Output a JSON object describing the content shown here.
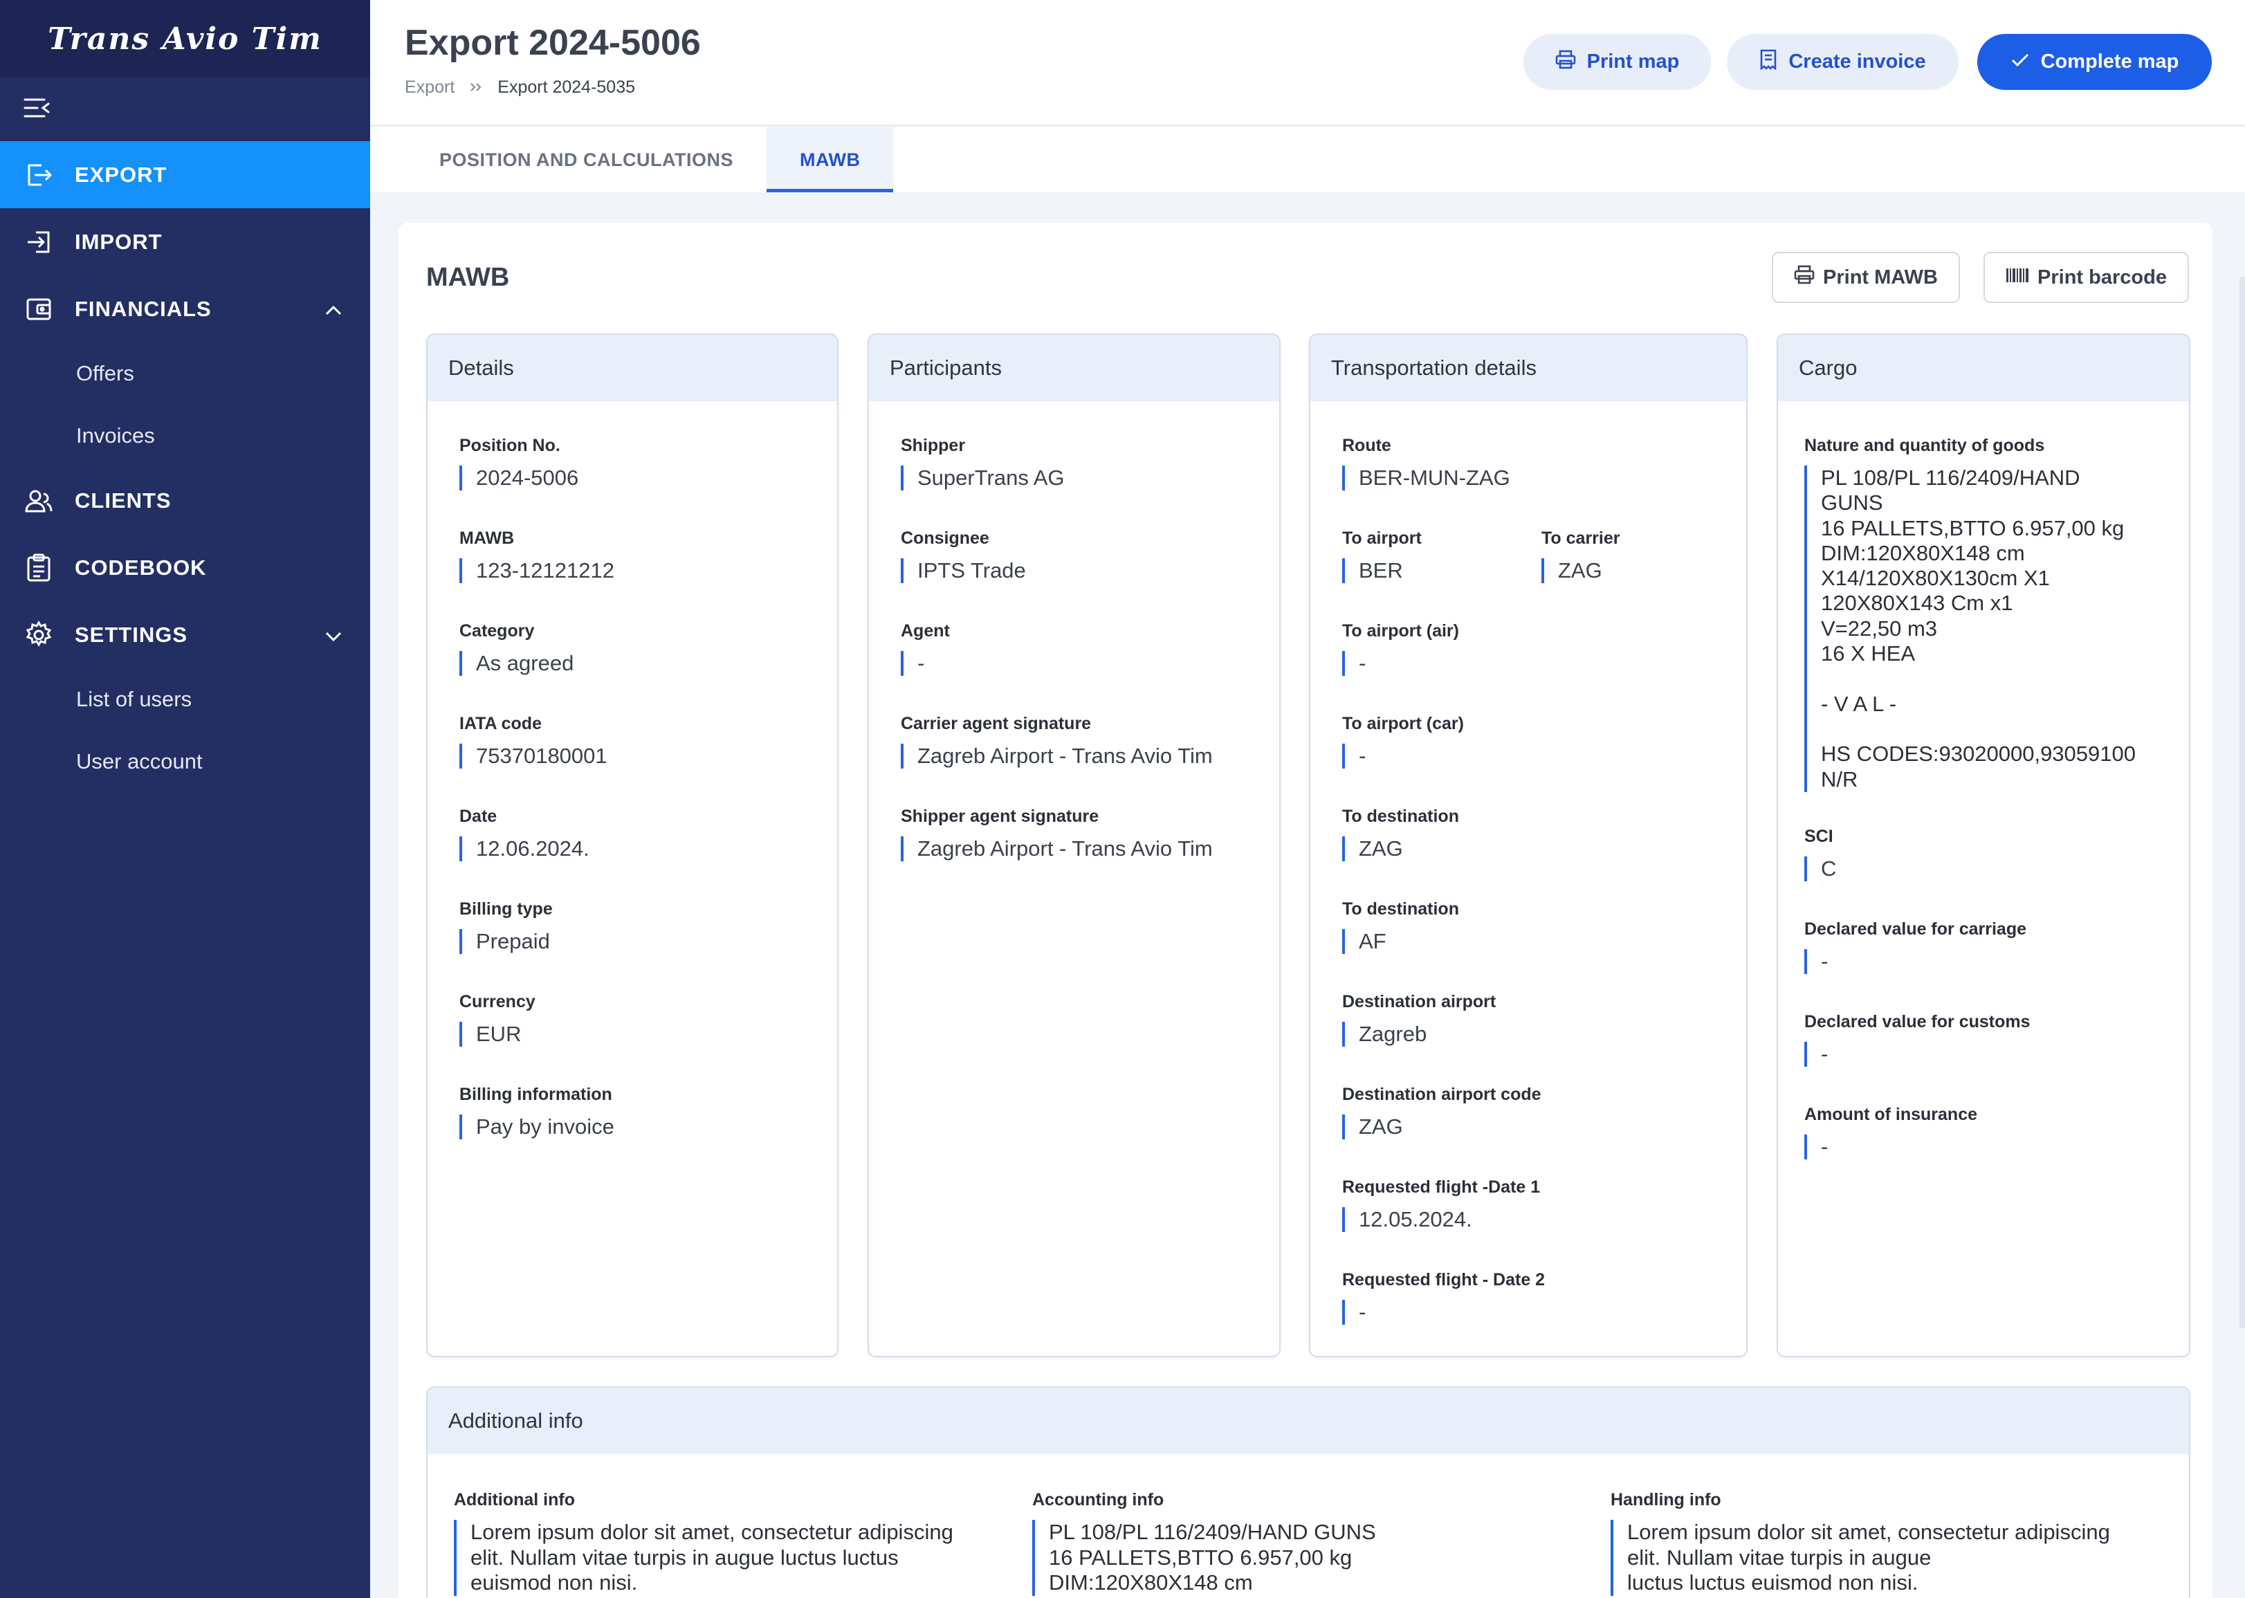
{
  "app": {
    "logo": "Trans Avio Tim"
  },
  "sidebar": {
    "items": [
      {
        "label": "EXPORT",
        "icon": "export-icon"
      },
      {
        "label": "IMPORT",
        "icon": "import-icon"
      },
      {
        "label": "FINANCIALS",
        "icon": "wallet-icon",
        "expanded": true,
        "children": [
          {
            "label": "Offers"
          },
          {
            "label": "Invoices"
          }
        ]
      },
      {
        "label": "CLIENTS",
        "icon": "users-icon"
      },
      {
        "label": "CODEBOOK",
        "icon": "clipboard-icon"
      },
      {
        "label": "SETTINGS",
        "icon": "gear-icon",
        "expanded": false,
        "children": [
          {
            "label": "List of users"
          },
          {
            "label": "User account"
          }
        ]
      }
    ]
  },
  "header": {
    "title": "Export 2024-5006",
    "breadcrumb": [
      "Export",
      "Export 2024-5035"
    ],
    "buttons": {
      "print_map": "Print map",
      "create_invoice": "Create invoice",
      "complete_map": "Complete map"
    }
  },
  "tabs": [
    {
      "label": "POSITION AND CALCULATIONS",
      "active": false
    },
    {
      "label": "MAWB",
      "active": true
    }
  ],
  "mawb": {
    "title": "MAWB",
    "buttons": {
      "print_mawb": "Print MAWB",
      "print_barcode": "Print barcode"
    },
    "details": {
      "title": "Details",
      "fields": [
        {
          "label": "Position No.",
          "value": "2024-5006"
        },
        {
          "label": "MAWB",
          "value": "123-12121212"
        },
        {
          "label": "Category",
          "value": "As agreed"
        },
        {
          "label": "IATA code",
          "value": "75370180001"
        },
        {
          "label": "Date",
          "value": "12.06.2024."
        },
        {
          "label": "Billing type",
          "value": "Prepaid"
        },
        {
          "label": "Currency",
          "value": "EUR"
        },
        {
          "label": "Billing information",
          "value": "Pay by invoice"
        }
      ]
    },
    "participants": {
      "title": "Participants",
      "fields": [
        {
          "label": "Shipper",
          "value": "SuperTrans AG"
        },
        {
          "label": "Consignee",
          "value": "IPTS Trade"
        },
        {
          "label": "Agent",
          "value": "-"
        },
        {
          "label": "Carrier agent signature",
          "value": "Zagreb Airport - Trans Avio Tim"
        },
        {
          "label": "Shipper agent signature",
          "value": "Zagreb Airport - Trans Avio Tim"
        }
      ]
    },
    "transport": {
      "title": "Transportation details",
      "route": {
        "label": "Route",
        "value": "BER-MUN-ZAG"
      },
      "to_airport": {
        "label": "To airport",
        "value": "BER"
      },
      "to_carrier": {
        "label": "To carrier",
        "value": "ZAG"
      },
      "fields": [
        {
          "label": "To airport (air)",
          "value": "-"
        },
        {
          "label": "To airport (car)",
          "value": "-"
        },
        {
          "label": "To destination",
          "value": "ZAG"
        },
        {
          "label": "To destination",
          "value": "AF"
        },
        {
          "label": "Destination airport",
          "value": "Zagreb"
        },
        {
          "label": "Destination airport code",
          "value": "ZAG"
        },
        {
          "label": "Requested flight -Date 1",
          "value": "12.05.2024."
        },
        {
          "label": "Requested flight - Date 2",
          "value": "-"
        }
      ]
    },
    "cargo": {
      "title": "Cargo",
      "goods": {
        "label": "Nature and quantity of goods",
        "value": "PL 108/PL 116/2409/HAND\nGUNS\n16 PALLETS,BTTO 6.957,00 kg\nDIM:120X80X148 cm\nX14/120X80X130cm X1\n120X80X143 Cm x1\nV=22,50 m3\n16 X HEA\n\n- V A L -\n\nHS CODES:93020000,93059100\nN/R"
      },
      "fields": [
        {
          "label": "SCI",
          "value": "C"
        },
        {
          "label": "Declared value for carriage",
          "value": "-"
        },
        {
          "label": "Declared value for customs",
          "value": "-"
        },
        {
          "label": "Amount of insurance",
          "value": "-"
        }
      ]
    },
    "additional": {
      "title": "Additional info",
      "cols": [
        {
          "label": "Additional info",
          "value": "Lorem ipsum dolor sit amet, consectetur adipiscing\nelit. Nullam vitae turpis in augue luctus luctus\neuismod non nisi."
        },
        {
          "label": "Accounting info",
          "value": "PL 108/PL 116/2409/HAND GUNS\n16 PALLETS,BTTO 6.957,00 kg\nDIM:120X80X148 cm"
        },
        {
          "label": "Handling info",
          "value": "Lorem ipsum dolor sit amet, consectetur adipiscing\nelit. Nullam vitae turpis in augue\nluctus luctus euismod non nisi."
        }
      ]
    }
  },
  "colors": {
    "sidebar": "#232e63",
    "active_nav": "#1491fb",
    "primary": "#1c5ee5",
    "accent_bar": "#2a62e0"
  }
}
